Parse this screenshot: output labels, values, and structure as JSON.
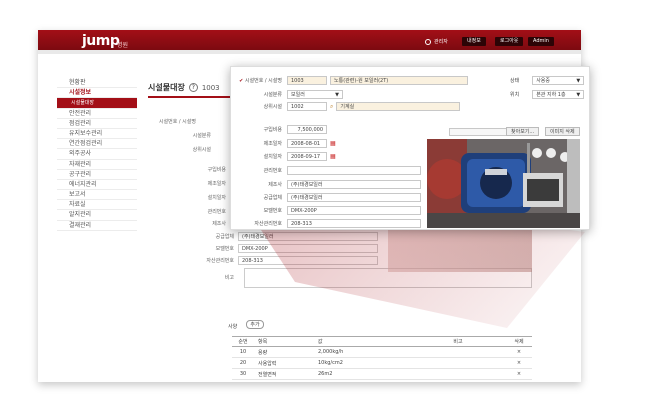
{
  "app": {
    "logo_text": "jump",
    "logo_sub": "병원",
    "user_label": "관리자",
    "top_buttons": [
      "내정보",
      "로그아웃",
      "Admin"
    ],
    "brand_color": "#a30f17"
  },
  "sidebar": {
    "items": [
      {
        "label": "현황판",
        "state": "normal"
      },
      {
        "label": "시설정보",
        "state": "current"
      },
      {
        "label": "시설물대장",
        "state": "active-sub"
      },
      {
        "label": "안전관리",
        "state": "normal"
      },
      {
        "label": "점검관리",
        "state": "normal"
      },
      {
        "label": "유지보수관리",
        "state": "normal"
      },
      {
        "label": "연간점검관리",
        "state": "normal"
      },
      {
        "label": "외주공사",
        "state": "normal"
      },
      {
        "label": "자재관리",
        "state": "normal"
      },
      {
        "label": "공구관리",
        "state": "normal"
      },
      {
        "label": "에너지관리",
        "state": "normal"
      },
      {
        "label": "보고서",
        "state": "normal"
      },
      {
        "label": "자료실",
        "state": "normal"
      },
      {
        "label": "알지관리",
        "state": "normal"
      },
      {
        "label": "결재관리",
        "state": "normal"
      }
    ]
  },
  "page": {
    "title": "시설물대장",
    "help_icon": "question-icon",
    "code": "1003"
  },
  "background_form": {
    "rows": [
      {
        "label": "시설번호 / 시설명",
        "value": ""
      },
      {
        "label": "시설분류",
        "value": ""
      },
      {
        "label": "상위시설",
        "value": ""
      },
      {
        "label": "구입비용",
        "value": ""
      },
      {
        "label": "제조일자",
        "value": ""
      },
      {
        "label": "설치일자",
        "value": ""
      },
      {
        "label": "관리번호",
        "value": ""
      },
      {
        "label": "제조사",
        "value": ""
      },
      {
        "label": "공급업체",
        "value": "(주)태경보일러"
      },
      {
        "label": "모델번호",
        "value": "DMX-200P"
      },
      {
        "label": "자산관리번호",
        "value": "208-313"
      },
      {
        "label": "비고",
        "value": ""
      }
    ]
  },
  "zoom": {
    "facility_label": "시설번호 / 시설명",
    "facility_no": "1003",
    "facility_name": "노통(관련)-원 보일러(2T)",
    "category_label": "시설분류",
    "category_value": "보일러",
    "parent_label": "상위시설",
    "parent_code": "1002",
    "parent_name": "기계실",
    "cost_label": "구입비용",
    "cost_value": "7,500,000",
    "mfg_date_label": "제조일자",
    "mfg_date_value": "2008-08-01",
    "install_date_label": "설치일자",
    "install_date_value": "2008-09-17",
    "mgmt_no_label": "관리번호",
    "mgmt_no_value": "",
    "maker_label": "제조사",
    "maker_value": "(주)태경보일러",
    "supplier_label": "공급업체",
    "supplier_value": "(주)태경보일러",
    "model_label": "모델번호",
    "model_value": "DMX-200P",
    "asset_no_label": "자산관리번호",
    "asset_no_value": "208-313",
    "status_label": "상태",
    "status_value": "사용중",
    "location_label": "위치",
    "location_value": "본관 지하 1층",
    "browse_label": "찾아보기...",
    "delete_image_label": "이미지 삭제"
  },
  "specs": {
    "section_label": "사양",
    "add_button": "추가",
    "columns": [
      "순번",
      "항목",
      "값",
      "비고",
      "삭제"
    ],
    "rows": [
      {
        "no": "10",
        "item": "용량",
        "value": "2,000kg/h",
        "note": "",
        "del": "×"
      },
      {
        "no": "20",
        "item": "사용압력",
        "value": "10kg/cm2",
        "note": "",
        "del": "×"
      },
      {
        "no": "30",
        "item": "전열면적",
        "value": "26m2",
        "note": "",
        "del": "×"
      }
    ]
  }
}
